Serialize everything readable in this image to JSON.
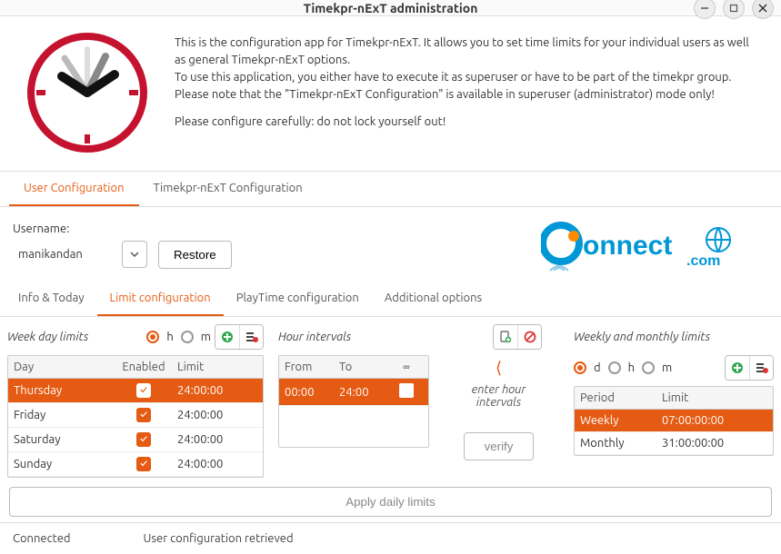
{
  "window": {
    "title": "Timekpr-nExT administration"
  },
  "header": {
    "p1": "This is the configuration app for Timekpr-nExT. It allows you to set time limits for your individual users as well as general Timekpr-nExT options.",
    "p2": "To use this application, you either have to execute it as superuser or have to be part of the timekpr group.",
    "p3": "Please note that the \"Timekpr-nExT Configuration\" is available in superuser (administrator) mode only!",
    "p4": "Please configure carefully: do not lock yourself out!"
  },
  "tabs": {
    "user_config": "User Configuration",
    "timekpr_config": "Timekpr-nExT Configuration"
  },
  "user": {
    "label": "Username:",
    "value": "manikandan",
    "restore": "Restore"
  },
  "brand": {
    "text1": "onnect",
    "text2": ".com"
  },
  "subtabs": {
    "info": "Info & Today",
    "limit": "Limit configuration",
    "playtime": "PlayTime configuration",
    "additional": "Additional options"
  },
  "weekday": {
    "title": "Week day limits",
    "radio_h": "h",
    "radio_m": "m",
    "headers": {
      "day": "Day",
      "enabled": "Enabled",
      "limit": "Limit"
    },
    "rows": [
      {
        "day": "Thursday",
        "enabled": true,
        "limit": "24:00:00",
        "selected": true
      },
      {
        "day": "Friday",
        "enabled": true,
        "limit": "24:00:00",
        "selected": false
      },
      {
        "day": "Saturday",
        "enabled": true,
        "limit": "24:00:00",
        "selected": false
      },
      {
        "day": "Sunday",
        "enabled": true,
        "limit": "24:00:00",
        "selected": false
      }
    ]
  },
  "intervals": {
    "title": "Hour intervals",
    "headers": {
      "from": "From",
      "to": "To",
      "inf": "∞"
    },
    "rows": [
      {
        "from": "00:00",
        "to": "24:00",
        "inf": false
      }
    ],
    "hint": "enter hour intervals",
    "verify": "verify"
  },
  "weekly": {
    "title": "Weekly and monthly limits",
    "radio_d": "d",
    "radio_h": "h",
    "radio_m": "m",
    "headers": {
      "period": "Period",
      "limit": "Limit"
    },
    "rows": [
      {
        "period": "Weekly",
        "limit": "07:00:00:00",
        "selected": true
      },
      {
        "period": "Monthly",
        "limit": "31:00:00:00",
        "selected": false
      }
    ]
  },
  "apply": "Apply daily limits",
  "status": {
    "connected": "Connected",
    "message": "User configuration retrieved"
  }
}
